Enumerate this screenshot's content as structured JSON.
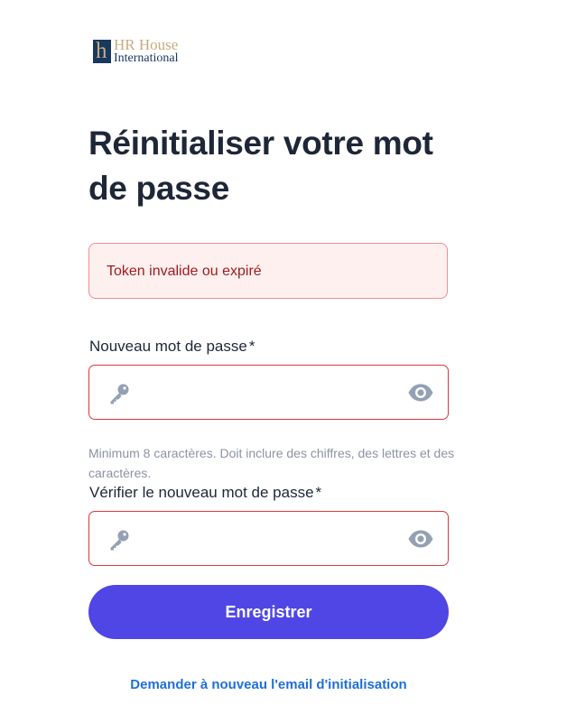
{
  "logo": {
    "mark": "h",
    "line1": "HR House",
    "line2": "International"
  },
  "title": "Réinitialiser votre mot de passe",
  "alert": {
    "message": "Token invalide ou expiré"
  },
  "new_password": {
    "label": "Nouveau mot de passe",
    "required_marker": "*",
    "value": "",
    "icon": "key-icon",
    "toggle_icon": "eye-icon"
  },
  "hint": "Minimum 8 caractères. Doit inclure des chiffres, des lettres et des caractères.",
  "confirm_password": {
    "label": "Vérifier le nouveau mot de passe",
    "required_marker": "*",
    "value": "",
    "icon": "key-icon",
    "toggle_icon": "eye-icon"
  },
  "submit_label": "Enregistrer",
  "resend_link": "Demander à nouveau l'email d'initialisation",
  "colors": {
    "primary": "#4f46e5",
    "error_border": "#d93a3a",
    "alert_bg": "#fff0f0",
    "alert_text": "#a11b1b",
    "link": "#1f6fd9",
    "icon_gray": "#94a0b4",
    "logo_gold": "#c8ab7d",
    "logo_navy": "#17385f"
  }
}
